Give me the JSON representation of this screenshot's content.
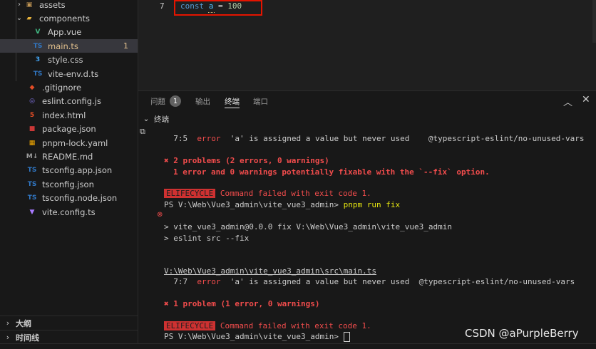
{
  "explorer": {
    "items": [
      {
        "label": "assets",
        "icon": "folder-assets-icon",
        "chev": "›",
        "badge": ""
      },
      {
        "label": "components",
        "icon": "folder-components-icon",
        "chev": "⌄",
        "badge": ""
      },
      {
        "label": "App.vue",
        "icon": "vue-icon",
        "chev": "",
        "badge": ""
      },
      {
        "label": "main.ts",
        "icon": "typescript-icon",
        "chev": "",
        "badge": "1"
      },
      {
        "label": "style.css",
        "icon": "css-icon",
        "chev": "",
        "badge": ""
      },
      {
        "label": "vite-env.d.ts",
        "icon": "typescript-icon",
        "chev": "",
        "badge": ""
      },
      {
        "label": ".gitignore",
        "icon": "git-icon",
        "chev": "",
        "badge": ""
      },
      {
        "label": "eslint.config.js",
        "icon": "eslint-icon",
        "chev": "",
        "badge": ""
      },
      {
        "label": "index.html",
        "icon": "html-icon",
        "chev": "",
        "badge": ""
      },
      {
        "label": "package.json",
        "icon": "npm-icon",
        "chev": "",
        "badge": ""
      },
      {
        "label": "pnpm-lock.yaml",
        "icon": "pnpm-icon",
        "chev": "",
        "badge": ""
      },
      {
        "label": "README.md",
        "icon": "markdown-icon",
        "chev": "",
        "badge": ""
      },
      {
        "label": "tsconfig.app.json",
        "icon": "tsconfig-icon",
        "chev": "",
        "badge": ""
      },
      {
        "label": "tsconfig.json",
        "icon": "tsconfig-icon",
        "chev": "",
        "badge": ""
      },
      {
        "label": "tsconfig.node.json",
        "icon": "tsconfig-icon",
        "chev": "",
        "badge": ""
      },
      {
        "label": "vite.config.ts",
        "icon": "vite-icon",
        "chev": "",
        "badge": ""
      }
    ],
    "outline_label": "大纲",
    "timeline_label": "时间线"
  },
  "editor": {
    "line_number": "7",
    "code": {
      "kw": "const",
      "var": "a",
      "op": " = ",
      "num": "100"
    }
  },
  "panel": {
    "tabs": {
      "problems": "问题",
      "problems_count": "1",
      "output": "输出",
      "terminal": "终端",
      "ports": "端口"
    },
    "terminal_title": "终端",
    "lines": {
      "l1_pos": "7:5",
      "l1_sev": "error",
      "l1_msg": "'a' is assigned a value but never used",
      "l1_rule": "@typescript-eslint/no-unused-vars",
      "l2": "✖ 2 problems (2 errors, 0 warnings)",
      "l3": "1 error and 0 warnings potentially fixable with the `--fix` option.",
      "lifecycle": "ELIFECYCLE",
      "failed": "Command failed with exit code 1.",
      "prompt1": "PS V:\\Web\\Vue3_admin\\vite_vue3_admin>",
      "cmd": "pnpm run fix",
      "l5": "> vite_vue3_admin@0.0.0 fix V:\\Web\\Vue3_admin\\vite_vue3_admin",
      "l6": "> eslint src --fix",
      "path": "V:\\Web\\Vue3_admin\\vite_vue3_admin\\src\\main.ts",
      "l8_pos": "7:7",
      "l8_sev": "error",
      "l8_msg": "'a' is assigned a value but never used",
      "l8_rule": "@typescript-eslint/no-unused-vars",
      "l9": "✖ 1 problem (1 error, 0 warnings)",
      "prompt2": "PS V:\\Web\\Vue3_admin\\vite_vue3_admin>"
    }
  },
  "watermark": "CSDN @aPurpleBerry",
  "colors": {
    "error": "#f14c4c",
    "accent": "#e51400",
    "selected": "#37373d"
  }
}
